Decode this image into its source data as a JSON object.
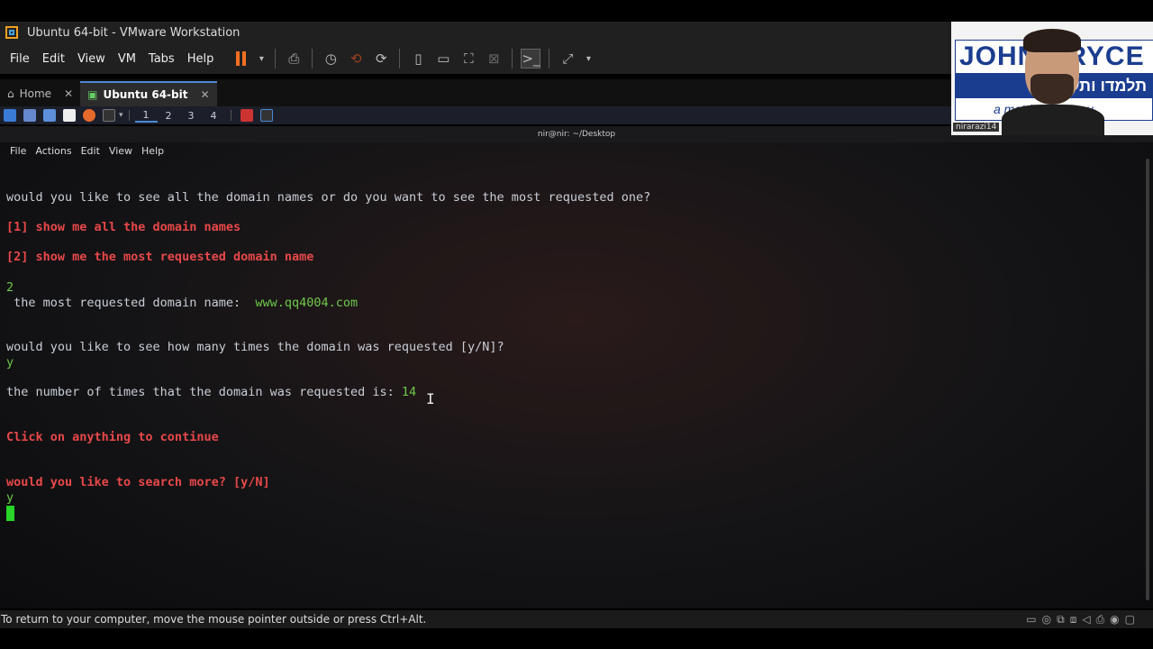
{
  "window": {
    "title": "Ubuntu 64-bit - VMware Workstation",
    "menu": [
      "File",
      "Edit",
      "View",
      "VM",
      "Tabs",
      "Help"
    ]
  },
  "tabs": [
    {
      "label": "Home",
      "active": false
    },
    {
      "label": "Ubuntu 64-bit",
      "active": true
    }
  ],
  "guest_panel": {
    "workspaces": [
      "1",
      "2",
      "3",
      "4"
    ]
  },
  "terminal": {
    "title": "nir@nir: ~/Desktop",
    "menu": [
      "File",
      "Actions",
      "Edit",
      "View",
      "Help"
    ],
    "lines": {
      "q1": "would you like to see all the domain names or do you want to see the most requested one?",
      "opt1": "[1] show me all the domain names",
      "opt2": "[2] show me the most requested domain name",
      "in1": "2",
      "most_label": " the most requested domain name:  ",
      "most_value": "www.qq4004.com",
      "q2": "would you like to see how many times the domain was requested [y/N]?",
      "in2": "y",
      "count_label": "the number of times that the domain was requested is: ",
      "count_value": "14",
      "continue": "Click on anything to continue",
      "q3": "would you like to search more? [y/N]",
      "in3": "y"
    }
  },
  "status_bar": {
    "text": "To return to your computer, move the mouse pointer outside or press Ctrl+Alt."
  },
  "webcam": {
    "logo_top": "JOHN BRYCE",
    "logo_mid": "תלמדו ותעבדו",
    "logo_bot": "a matrix company",
    "name_label": "nirarazi14"
  },
  "colors": {
    "prompt_red": "#e8484a",
    "input_green": "#6ec84a",
    "cursor_green": "#27d427",
    "pause_orange": "#f36f21"
  }
}
